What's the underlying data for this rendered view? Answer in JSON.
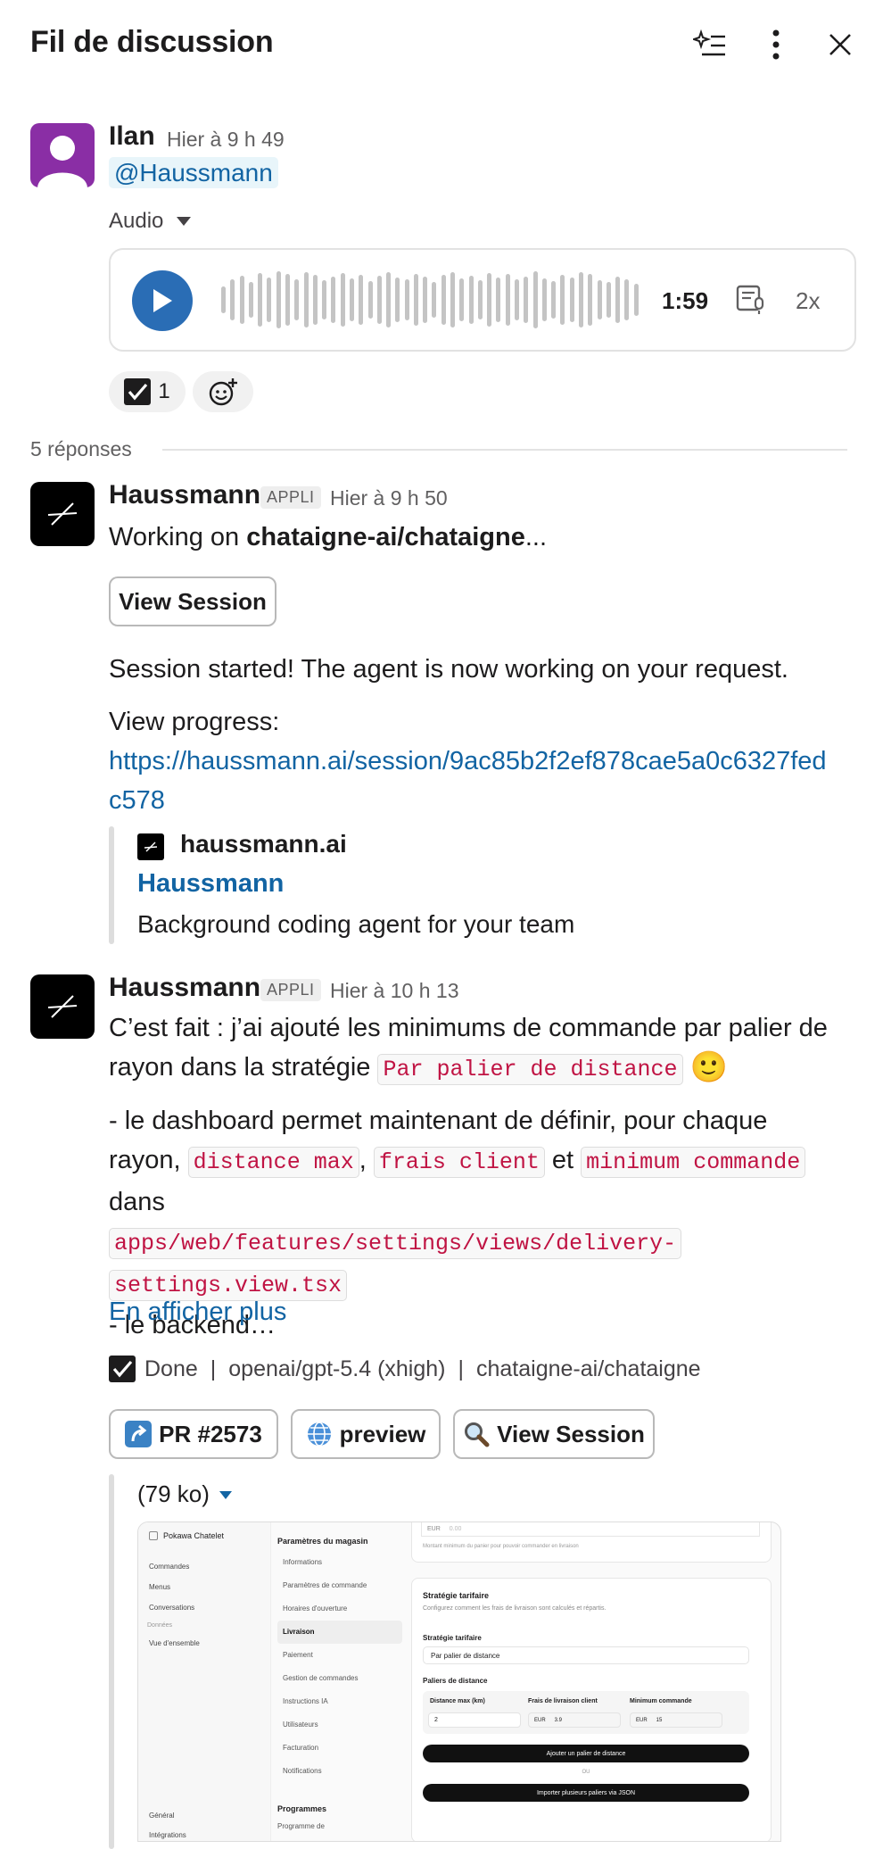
{
  "header": {
    "title": "Fil de discussion"
  },
  "parent_message": {
    "author": "Ilan",
    "time": "Hier à 9 h 49",
    "mention": "@Haussmann",
    "audio_label": "Audio",
    "audio_duration": "1:59",
    "audio_speed": "2x",
    "reaction_count": "1"
  },
  "replies_label": "5 réponses",
  "reply1": {
    "author": "Haussmann",
    "badge": "APPLI",
    "time": "Hier à 9 h 50",
    "working_prefix": "Working on ",
    "working_repo": "chataigne-ai/chataigne",
    "working_suffix": "...",
    "view_session_label": "View Session",
    "session_started": "Session started! The agent is now working on your request.",
    "view_progress": "View progress:",
    "progress_url_line1": "https://haussmann.ai/session/9ac85b2f2ef878cae5a0c6327fed",
    "progress_url_line2": "c578",
    "unfurl": {
      "site": "haussmann.ai",
      "title": "Haussmann",
      "description": "Background coding agent for your team"
    }
  },
  "reply2": {
    "author": "Haussmann",
    "badge": "APPLI",
    "time": "Hier à 10 h 13",
    "line1": "C’est fait : j’ai ajouté les minimums de commande par palier de",
    "line2_prefix": "rayon dans la stratégie ",
    "line2_code": "Par palier de distance",
    "line2_emoji": "🙂",
    "p2_line1": "- le dashboard permet maintenant de définir, pour chaque",
    "p2_line2_prefix": "rayon, ",
    "code_distance": "distance max",
    "comma": ",",
    "code_frais": "frais client",
    "and_word": "et",
    "code_minimum": "minimum commande",
    "in_word": "dans",
    "code_path1": "apps/web/features/settings/views/delivery-",
    "code_path2": "settings.view.tsx",
    "backend_line": "- le backend…",
    "show_more": "En afficher plus",
    "status_done": "Done",
    "status_model": "openai/gpt-5.4 (xhigh)",
    "status_repo": "chataigne-ai/chataigne",
    "status_sep": "|",
    "btn_pr": "PR #2573",
    "btn_preview": "preview",
    "btn_view_session": "View Session",
    "attachment_size": "(79 ko)"
  },
  "screenshot": {
    "store_name": "Pokawa Chatelet",
    "nav": [
      "Commandes",
      "Menus",
      "Conversations"
    ],
    "nav_section": "Données",
    "nav_overview": "Vue d'ensemble",
    "nav_bottom": [
      "Général",
      "Intégrations"
    ],
    "settings_title": "Paramètres du magasin",
    "settings_items": [
      "Informations",
      "Paramètres de commande",
      "Horaires d'ouverture",
      "Livraison",
      "Paiement",
      "Gestion de commandes",
      "Instructions IA",
      "Utilisateurs",
      "Facturation",
      "Notifications"
    ],
    "programs_title": "Programmes",
    "programs_item": "Programme de",
    "min_eur": "EUR",
    "min_value": "0.00",
    "min_help": "Montant minimum du panier pour pouvoir commander en livraison",
    "strategy_title": "Stratégie tarifaire",
    "strategy_desc": "Configurez comment les frais de livraison sont calculés et répartis.",
    "strategy_label": "Stratégie tarifaire",
    "strategy_value": "Par palier de distance",
    "tiers_label": "Paliers de distance",
    "col_distance": "Distance max (km)",
    "col_frais": "Frais de livraison client",
    "col_min": "Minimum commande",
    "row_distance": "2",
    "row_eur1": "EUR",
    "row_frais": "3.9",
    "row_eur2": "EUR",
    "row_min": "15",
    "btn_add_tier": "Ajouter un palier de distance",
    "or_label": "OU",
    "btn_import": "Importer plusieurs paliers via JSON"
  }
}
